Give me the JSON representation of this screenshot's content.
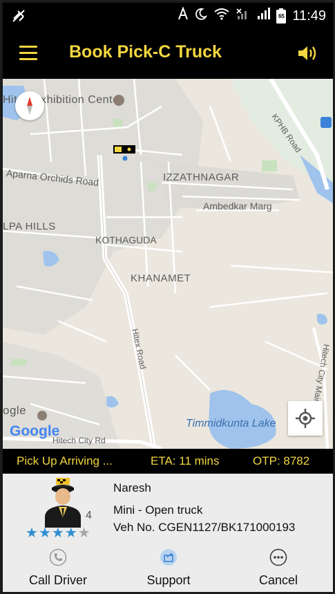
{
  "status_bar": {
    "time": "11:49",
    "icons": [
      "no-mobile-data-icon",
      "auto-brightness-icon",
      "night-mode-icon",
      "wifi-icon",
      "signal-muted-icon",
      "signal-icon",
      "battery-icon"
    ],
    "battery_level": "65"
  },
  "app_bar": {
    "title": "Book Pick-C Truck",
    "menu_icon": "hamburger-menu-icon",
    "sound_icon": "speaker-icon"
  },
  "map": {
    "labels": {
      "hitex_exhibition": "Hitex Exhibition Center",
      "kphb_road": "KPHB Road",
      "aparna_orchids": "Aparna Orchids Road",
      "izzathnagar": "IZZATHNAGAR",
      "ambedkar_marg": "Ambedkar Marg",
      "alpa_hills": "LPA HILLS",
      "kothaguda": "KOTHAGUDA",
      "khanamet": "KHANAMET",
      "hitex_road": "Hitex Road",
      "hitech_city_main": "Hitech City Main Rd",
      "timmidkunta": "Timmidkunta Lake",
      "google_partial": "ogle",
      "hitech_city_rd": "Hitech City Rd",
      "google_logo": "Google"
    },
    "compass_icon": "compass-icon",
    "locate_icon": "my-location-icon"
  },
  "trip_strip": {
    "status": "Pick Up Arriving ...",
    "eta": "ETA: 11 mins",
    "otp": "OTP: 8782"
  },
  "driver": {
    "name": "Naresh",
    "vehicle_type": "Mini - Open truck",
    "vehicle_no": "Veh No. CGEN1127/BK171000193",
    "rating_text": "4",
    "rating_value": 4,
    "rating_max": 5
  },
  "actions": {
    "call": "Call Driver",
    "support": "Support",
    "cancel": "Cancel"
  },
  "colors": {
    "accent": "#f2d640",
    "star": "#2f8fd0",
    "star_empty": "#a5a5a5",
    "water": "#9fc3ec"
  }
}
